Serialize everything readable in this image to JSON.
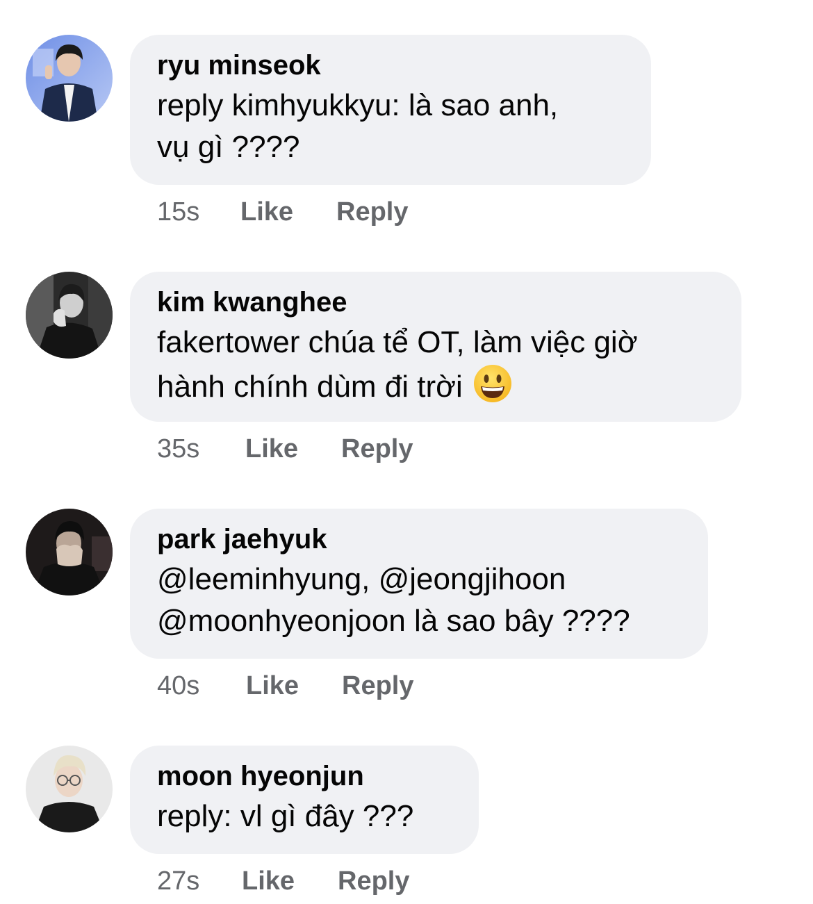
{
  "comments": [
    {
      "author": "ryu minseok",
      "lines": [
        "reply kimhyukkyu: là sao anh,",
        "vụ gì ????"
      ],
      "time": "15s",
      "like_label": "Like",
      "reply_label": "Reply",
      "avatar_icon": "avatar-photo"
    },
    {
      "author": "kim kwanghee",
      "lines": [
        "fakertower chúa tể OT, làm việc giờ",
        "hành chính dùm đi trời"
      ],
      "emoji": "grinning-face-emoji",
      "time": "35s",
      "like_label": "Like",
      "reply_label": "Reply",
      "avatar_icon": "avatar-photo"
    },
    {
      "author": "park jaehyuk",
      "lines": [
        "@leeminhyung, @jeongjihoon",
        "@moonhyeonjoon là sao bây ????"
      ],
      "time": "40s",
      "like_label": "Like",
      "reply_label": "Reply",
      "avatar_icon": "avatar-photo"
    },
    {
      "author": "moon hyeonjun",
      "lines": [
        "reply: vl gì đây ???"
      ],
      "time": "27s",
      "like_label": "Like",
      "reply_label": "Reply",
      "avatar_icon": "avatar-photo"
    }
  ],
  "colors": {
    "bubble_bg": "#f0f1f4",
    "text": "#050505",
    "meta": "#65676b"
  }
}
